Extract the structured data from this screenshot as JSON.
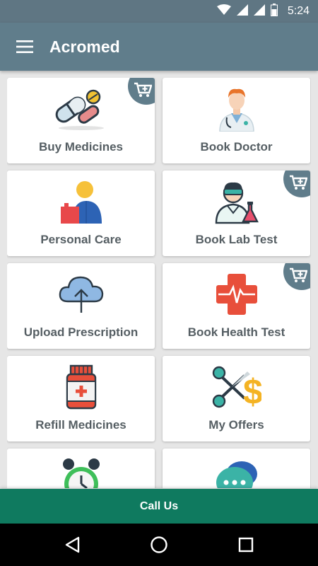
{
  "status_bar": {
    "time": "5:24",
    "icons": [
      "wifi-icon",
      "signal-icon",
      "signal-icon",
      "battery-icon"
    ]
  },
  "app_bar": {
    "title": "Acromed",
    "menu_icon": "hamburger-menu-icon"
  },
  "tiles": [
    {
      "label": "Buy Medicines",
      "icon": "pills-icon",
      "cart_badge": true
    },
    {
      "label": "Book Doctor",
      "icon": "doctor-icon",
      "cart_badge": false
    },
    {
      "label": "Personal Care",
      "icon": "personal-care-icon",
      "cart_badge": false
    },
    {
      "label": "Book Lab Test",
      "icon": "lab-technician-icon",
      "cart_badge": true
    },
    {
      "label": "Upload Prescription",
      "icon": "cloud-upload-icon",
      "cart_badge": false
    },
    {
      "label": "Book Health Test",
      "icon": "medical-cross-icon",
      "cart_badge": true
    },
    {
      "label": "Refill Medicines",
      "icon": "medicine-bottle-icon",
      "cart_badge": false
    },
    {
      "label": "My Offers",
      "icon": "offers-scissors-dollar-icon",
      "cart_badge": false
    },
    {
      "label": "",
      "icon": "alarm-clock-icon",
      "cart_badge": false
    },
    {
      "label": "",
      "icon": "chat-bubble-icon",
      "cart_badge": false
    }
  ],
  "footer": {
    "call_label": "Call Us"
  },
  "nav_bar": {
    "buttons": [
      "back-icon",
      "home-icon",
      "recents-icon"
    ]
  },
  "colors": {
    "primary": "#607d8b",
    "call_bar": "#0f7a5f",
    "tile_text": "#555e63"
  }
}
